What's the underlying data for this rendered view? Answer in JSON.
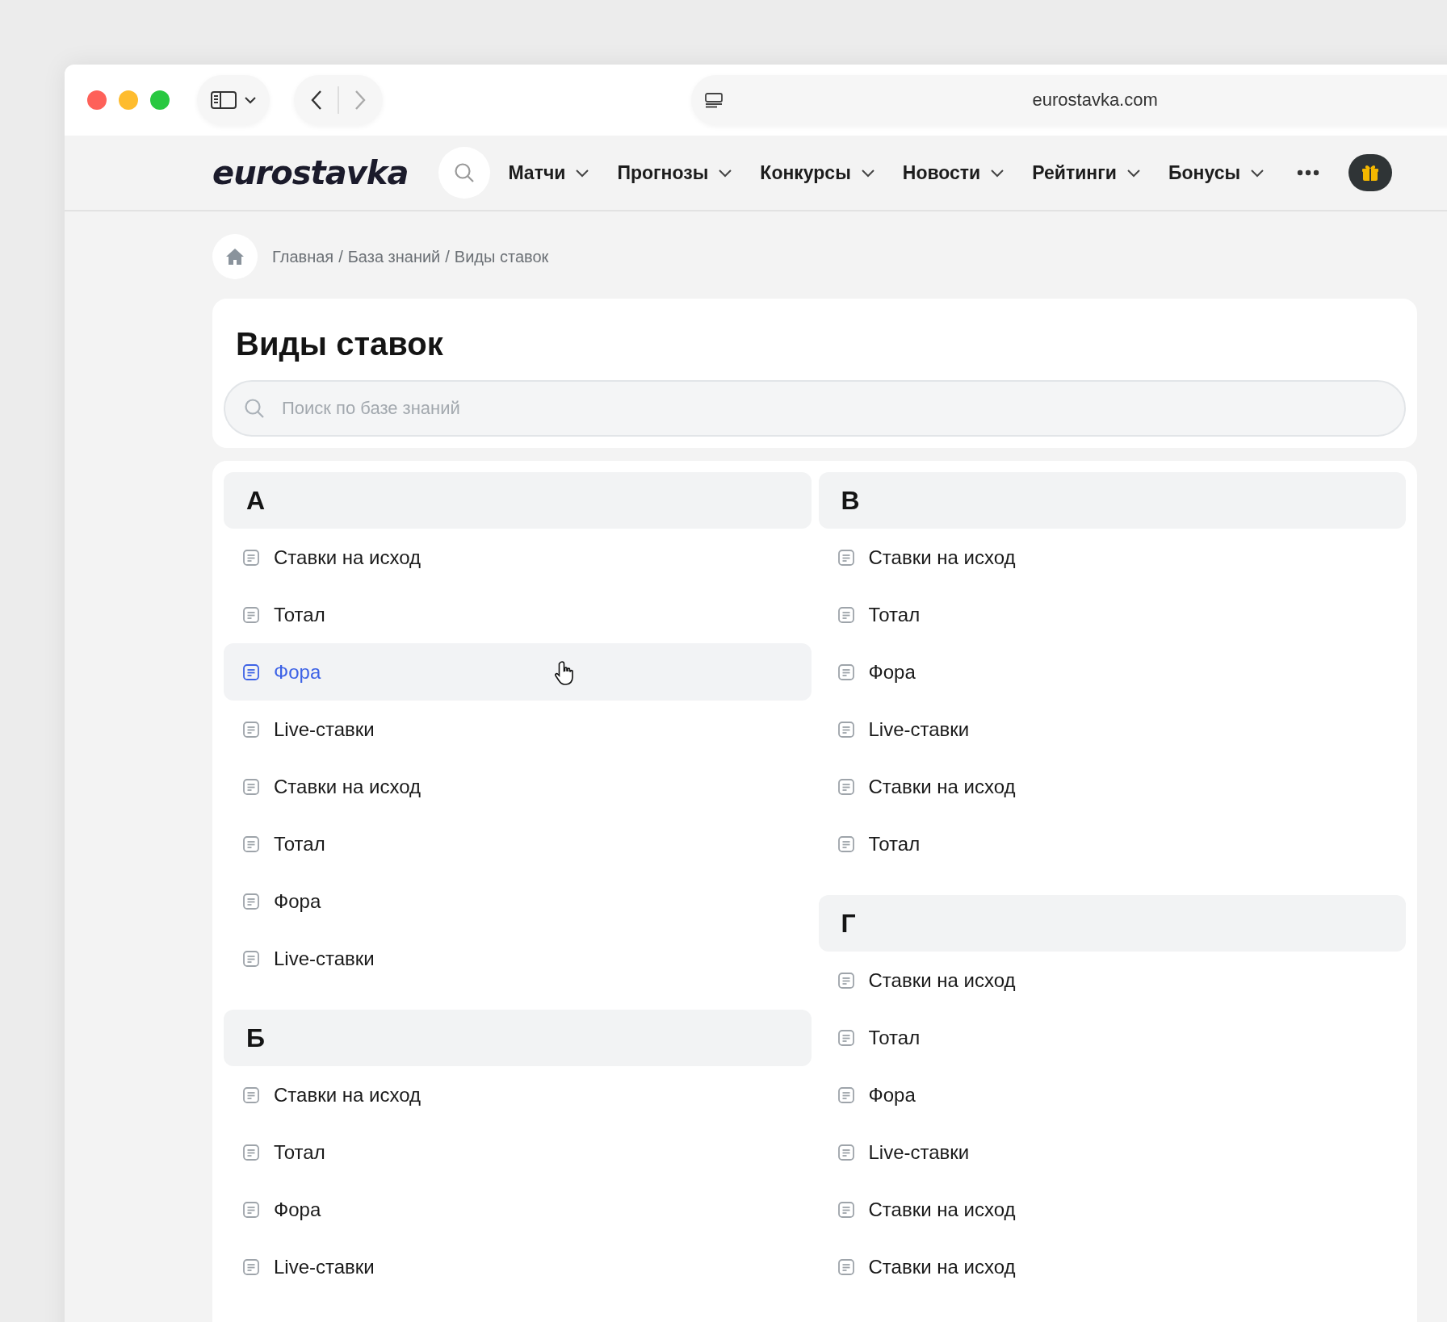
{
  "browser": {
    "url": "eurostavka.com"
  },
  "header": {
    "logo": "eurostavka",
    "nav": [
      {
        "label": "Матчи"
      },
      {
        "label": "Прогнозы"
      },
      {
        "label": "Конкурсы"
      },
      {
        "label": "Новости"
      },
      {
        "label": "Рейтинги"
      },
      {
        "label": "Бонусы"
      }
    ]
  },
  "breadcrumb": {
    "separator": "/",
    "items": [
      "Главная",
      "База знаний",
      "Виды ставок"
    ]
  },
  "title": "Виды ставок",
  "search": {
    "placeholder": "Поиск по базе знаний"
  },
  "columns": [
    {
      "sections": [
        {
          "letter": "А",
          "items": [
            {
              "label": "Ставки на исход",
              "selected": false
            },
            {
              "label": "Тотал",
              "selected": false
            },
            {
              "label": "Фора",
              "selected": true
            },
            {
              "label": "Live-ставки",
              "selected": false
            },
            {
              "label": "Ставки на исход",
              "selected": false
            },
            {
              "label": "Тотал",
              "selected": false
            },
            {
              "label": "Фора",
              "selected": false
            },
            {
              "label": "Live-ставки",
              "selected": false
            }
          ]
        },
        {
          "letter": "Б",
          "items": [
            {
              "label": "Ставки на исход",
              "selected": false
            },
            {
              "label": "Тотал",
              "selected": false
            },
            {
              "label": "Фора",
              "selected": false
            },
            {
              "label": "Live-ставки",
              "selected": false
            }
          ]
        }
      ]
    },
    {
      "sections": [
        {
          "letter": "В",
          "items": [
            {
              "label": "Ставки на исход",
              "selected": false
            },
            {
              "label": "Тотал",
              "selected": false
            },
            {
              "label": "Фора",
              "selected": false
            },
            {
              "label": "Live-ставки",
              "selected": false
            },
            {
              "label": "Ставки на исход",
              "selected": false
            },
            {
              "label": "Тотал",
              "selected": false
            }
          ]
        },
        {
          "letter": "Г",
          "items": [
            {
              "label": "Ставки на исход",
              "selected": false
            },
            {
              "label": "Тотал",
              "selected": false
            },
            {
              "label": "Фора",
              "selected": false
            },
            {
              "label": "Live-ставки",
              "selected": false
            },
            {
              "label": "Ставки на исход",
              "selected": false
            },
            {
              "label": "Ставки на исход",
              "selected": false
            }
          ]
        }
      ]
    }
  ]
}
